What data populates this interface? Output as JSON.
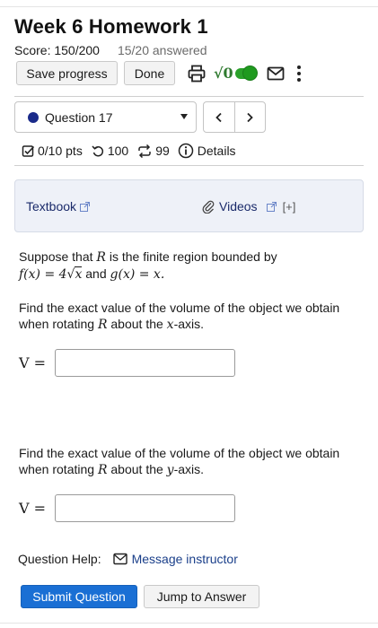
{
  "header": {
    "title": "Week 6 Homework 1",
    "score": "Score: 150/200",
    "answered": "15/20 answered"
  },
  "toolbar": {
    "save_label": "Save progress",
    "done_label": "Done",
    "sqrt_label": "√0"
  },
  "question_nav": {
    "selected": "Question 17",
    "prev": "‹",
    "next": "›"
  },
  "meta": {
    "points": "0/10 pts",
    "retries": "100",
    "attempts": "99",
    "details": "Details"
  },
  "resources": {
    "textbook": "Textbook",
    "videos": "Videos",
    "more": "[+]"
  },
  "problem": {
    "intro_pre": "Suppose that ",
    "intro_var": "R",
    "intro_post": " is the finite region bounded by",
    "f_def": "f(x) = 4",
    "f_rad": "x",
    "and": " and ",
    "g_def": "g(x) = x.",
    "part1_pre": "Find the exact value of the volume of the object we obtain when rotating ",
    "part1_var": "R",
    "part1_mid": " about the ",
    "part1_axis": "x",
    "part1_post": "-axis.",
    "part2_pre": "Find the exact value of the volume of the object we obtain when rotating ",
    "part2_var": "R",
    "part2_mid": " about the ",
    "part2_axis": "y",
    "part2_post": "-axis.",
    "answer_label": "V =",
    "answer1_value": "",
    "answer2_value": ""
  },
  "help": {
    "label": "Question Help:",
    "message": "Message instructor"
  },
  "actions": {
    "submit": "Submit Question",
    "jump": "Jump to Answer"
  },
  "colors": {
    "accent": "#1a6fd4",
    "toggle_on": "#2aa12a",
    "link": "#1a3f8a",
    "question_dot": "#1a2a8a"
  }
}
